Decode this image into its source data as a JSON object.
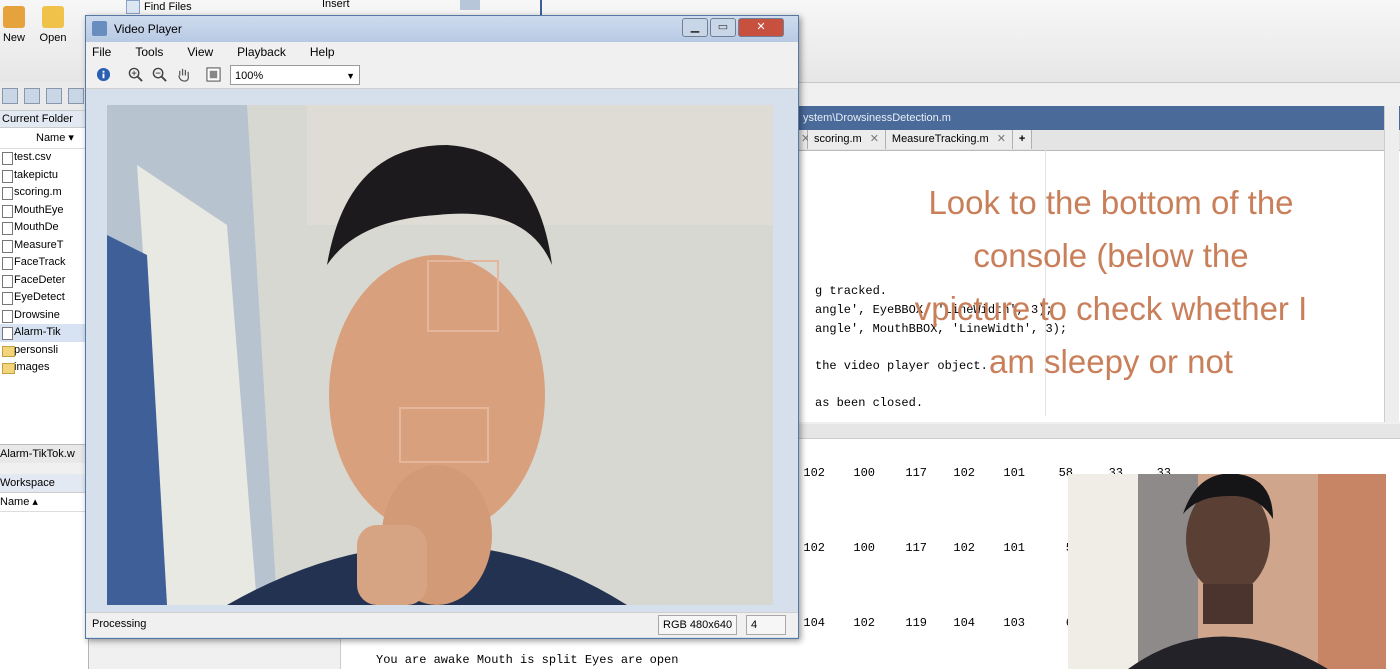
{
  "ribbon": {
    "new_label": "New",
    "open_label": "Open",
    "find_files_label": "Find Files",
    "insert_label": "Insert"
  },
  "folder_panel": {
    "title": "Current Folder",
    "name_header": "Name",
    "files": [
      "test.csv",
      "takepictu",
      "scoring.m",
      "MouthEye",
      "MouthDe",
      "MeasureT",
      "FaceTrack",
      "FaceDeter",
      "EyeDetect",
      "Drowsine",
      "Alarm-Tik",
      "personsli",
      "images"
    ],
    "status": "Alarm-TikTok.w"
  },
  "workspace": {
    "title": "Workspace",
    "name_header": "Name"
  },
  "editor": {
    "path": "ystem\\DrowsinessDetection.m",
    "tabs": [
      "scoring.m",
      "MeasureTracking.m"
    ],
    "new_tab": "+",
    "code_lines": [
      "g tracked.",
      "angle', EyeBBOX, 'LineWidth', 3);",
      "angle', MouthBBOX, 'LineWidth', 3);",
      "the video player object.",
      "as been closed."
    ],
    "overlay_lines": [
      "Look to the bottom of the",
      "console (below the",
      "vpicture to check whether I",
      "am sleepy or not"
    ],
    "overlay_color": "#c87f5a"
  },
  "command_window": {
    "rows": [
      [
        "102",
        "100",
        "117",
        "102",
        "101",
        "58",
        "33",
        "33"
      ],
      [
        "102",
        "100",
        "117",
        "102",
        "101",
        "5"
      ],
      [
        "104",
        "102",
        "119",
        "104",
        "103",
        "6"
      ]
    ],
    "status_line": "You are awake Mouth is split Eyes are open"
  },
  "video_player": {
    "title": "Video Player",
    "menus": [
      "File",
      "Tools",
      "View",
      "Playback",
      "Help"
    ],
    "zoom": "100%",
    "status": "Processing",
    "format": "RGB 480x640",
    "frame": "4"
  }
}
